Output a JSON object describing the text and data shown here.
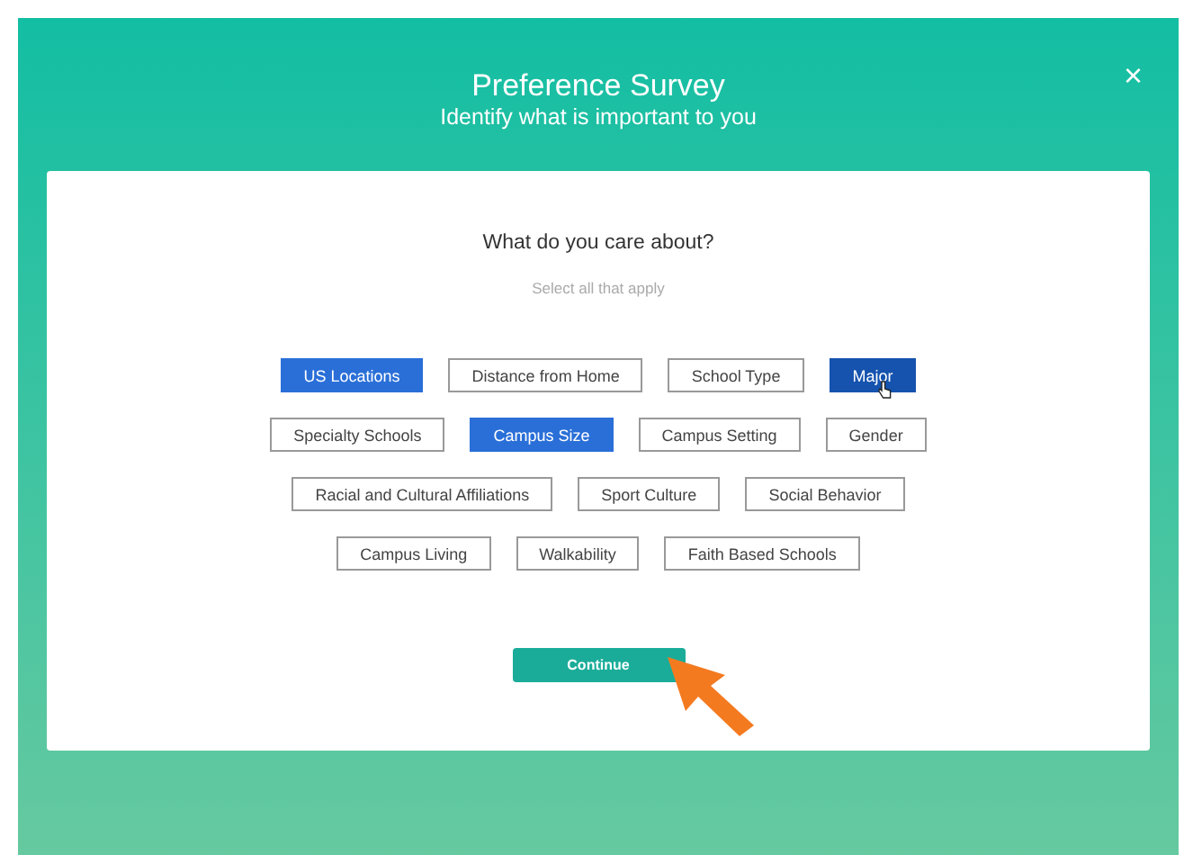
{
  "title": "Preference Survey",
  "subtitle": "Identify what is important to you",
  "close": "×",
  "question": "What do you care about?",
  "hint": "Select all that apply",
  "option_rows": [
    [
      {
        "label": "US Locations",
        "selected": true,
        "hovered": false
      },
      {
        "label": "Distance from Home",
        "selected": false,
        "hovered": false
      },
      {
        "label": "School Type",
        "selected": false,
        "hovered": false
      },
      {
        "label": "Major",
        "selected": true,
        "hovered": true
      }
    ],
    [
      {
        "label": "Specialty Schools",
        "selected": false,
        "hovered": false
      },
      {
        "label": "Campus Size",
        "selected": true,
        "hovered": false
      },
      {
        "label": "Campus Setting",
        "selected": false,
        "hovered": false
      },
      {
        "label": "Gender",
        "selected": false,
        "hovered": false
      }
    ],
    [
      {
        "label": "Racial and Cultural Affiliations",
        "selected": false,
        "hovered": false
      },
      {
        "label": "Sport Culture",
        "selected": false,
        "hovered": false
      },
      {
        "label": "Social Behavior",
        "selected": false,
        "hovered": false
      }
    ],
    [
      {
        "label": "Campus Living",
        "selected": false,
        "hovered": false
      },
      {
        "label": "Walkability",
        "selected": false,
        "hovered": false
      },
      {
        "label": "Faith Based Schools",
        "selected": false,
        "hovered": false
      }
    ]
  ],
  "continue_button": "Continue"
}
